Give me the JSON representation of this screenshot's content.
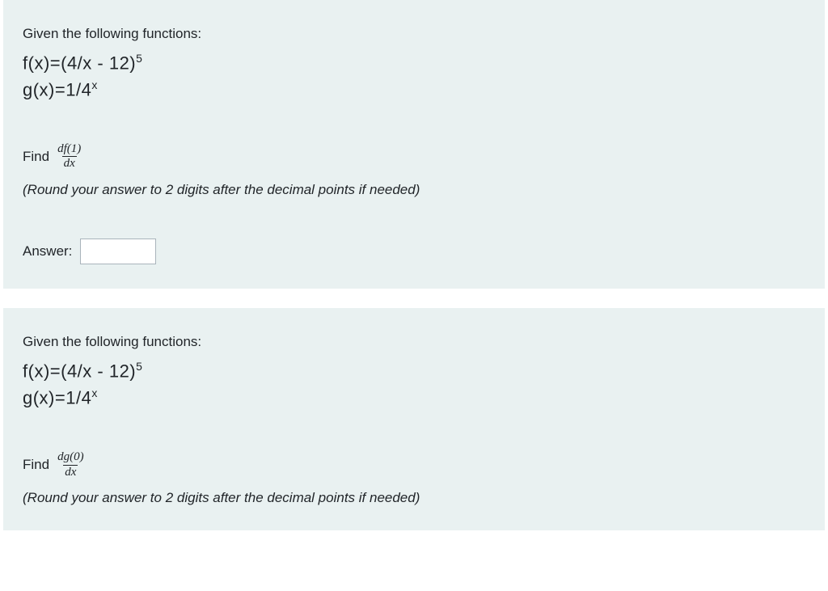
{
  "questions": [
    {
      "intro": "Given the following functions:",
      "f_expr_pre": "f(x)=(4/x - 12)",
      "f_expr_sup": "5",
      "g_expr_pre": "g(x)=1/4",
      "g_expr_sup": "x",
      "find_label": "Find",
      "find_frac_num": "df(1)",
      "find_frac_den": "dx",
      "round_hint": "(Round your answer to 2 digits after the decimal points if needed)",
      "answer_label": "Answer:",
      "answer_value": ""
    },
    {
      "intro": "Given the following functions:",
      "f_expr_pre": "f(x)=(4/x - 12)",
      "f_expr_sup": "5",
      "g_expr_pre": "g(x)=1/4",
      "g_expr_sup": "x",
      "find_label": "Find",
      "find_frac_num": "dg(0)",
      "find_frac_den": "dx",
      "round_hint": "(Round your answer to 2 digits after the decimal points if needed)"
    }
  ]
}
